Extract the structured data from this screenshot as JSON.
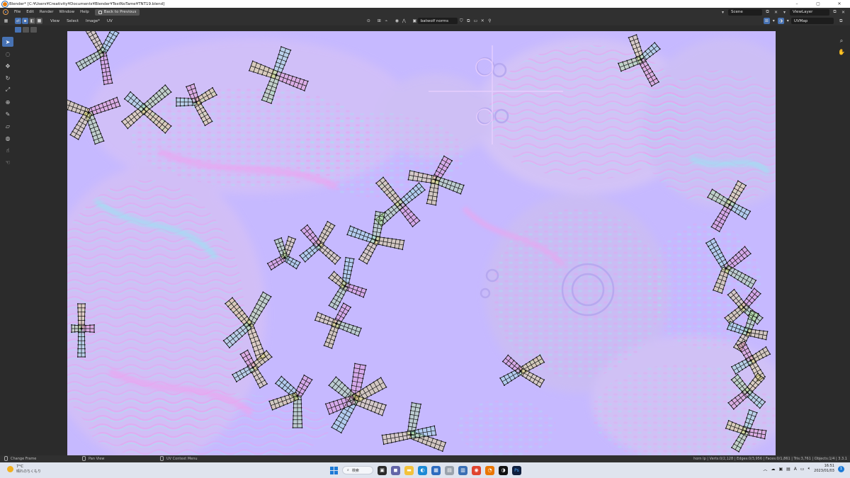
{
  "window": {
    "title": "Blender* [C:¥Users¥Creativity¥Documents¥Blender¥TestNoTame¥TNT19.blend]",
    "minimize": "–",
    "maximize": "▢",
    "close": "✕"
  },
  "topbar": {
    "menus": [
      "File",
      "Edit",
      "Render",
      "Window",
      "Help"
    ],
    "back_button": "Back to Previous",
    "scene": "Scene",
    "view_layer": "ViewLayer"
  },
  "editor_header": {
    "menus": [
      "View",
      "Select",
      "Image*",
      "UV"
    ],
    "image_name": "batwolf norms",
    "uv_map": "UVMap"
  },
  "statusbar": {
    "hint1": "Change Frame",
    "hint2": "Pan View",
    "hint3": "UV Context Menu",
    "stats": "horn lp | Verts:0/2,128 | Edges:0/3,956 | Faces:0/1,861 | Tris:3,761 | Objects:1/4 | 3.3.1"
  },
  "taskbar": {
    "temperature": "7°C",
    "weather": "晴れのちくもり",
    "search": "検索",
    "time": "16:51",
    "date": "2023/01/03",
    "notification_count": "1"
  },
  "colors": {
    "canvas_base": "#c9bcff",
    "accent": "#4772b3",
    "uv_line": "#111111"
  }
}
